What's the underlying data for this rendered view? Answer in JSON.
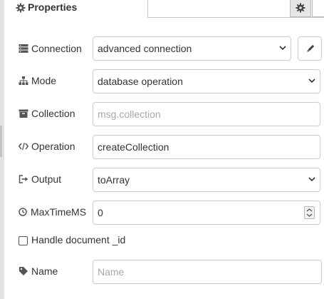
{
  "tab": {
    "title": "Properties",
    "icon": "cog-icon"
  },
  "fields": {
    "connection": {
      "label": "Connection",
      "value": "advanced connection",
      "icon": "server-icon"
    },
    "mode": {
      "label": "Mode",
      "value": "database operation",
      "icon": "sitemap-icon"
    },
    "collection": {
      "label": "Collection",
      "placeholder": "msg.collection",
      "value": "",
      "icon": "archive-icon"
    },
    "operation": {
      "label": "Operation",
      "value": "createCollection",
      "icon": "code-icon"
    },
    "output": {
      "label": "Output",
      "value": "toArray",
      "icon": "sign-out-icon"
    },
    "maxtimems": {
      "label": "MaxTimeMS",
      "value": "0",
      "icon": "clock-icon"
    },
    "handle_id": {
      "label": "Handle document _id",
      "checked": false
    },
    "name": {
      "label": "Name",
      "placeholder": "Name",
      "value": "",
      "icon": "tag-icon"
    }
  },
  "colors": {
    "border": "#cccccc",
    "placeholder": "#a8a8a8",
    "text": "#333333",
    "tab_button_bg": "#e6e6e6"
  }
}
